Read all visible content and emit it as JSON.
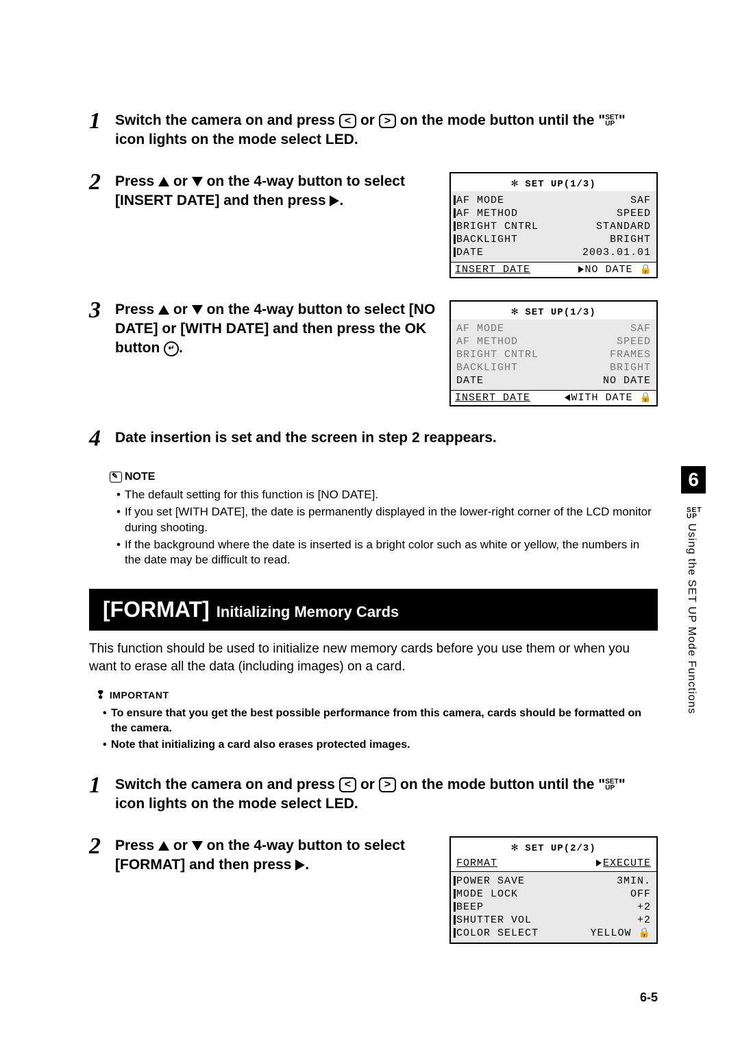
{
  "steps_a": {
    "s1": {
      "pre": "Switch the camera on and press ",
      "mid": " or ",
      "post": " on the mode button until the \"",
      "post2": "\" icon lights on the mode select LED."
    },
    "s2": {
      "pre": "Press ",
      "mid": " or ",
      "post": " on the 4-way button to select [INSERT DATE] and then press ",
      "post2": "."
    },
    "s3": {
      "pre": "Press ",
      "mid": " or ",
      "post": " on the 4-way button to select [NO DATE] or [WITH DATE] and then press the OK button ",
      "post2": "."
    },
    "s4": "Date insertion is set and the screen in step 2 reappears."
  },
  "setup1": {
    "title": "SET UP(1/3)",
    "rows": [
      {
        "label": "AF MODE",
        "value": "SAF"
      },
      {
        "label": "AF METHOD",
        "value": "SPEED"
      },
      {
        "label": "BRIGHT CNTRL",
        "value": "STANDARD"
      },
      {
        "label": "BACKLIGHT",
        "value": "BRIGHT"
      },
      {
        "label": "DATE",
        "value": "2003.01.01"
      }
    ],
    "footer": {
      "label": "INSERT DATE",
      "value": "NO DATE"
    }
  },
  "setup2": {
    "title": "SET UP(1/3)",
    "rows": [
      {
        "label": "AF MODE",
        "value": "SAF"
      },
      {
        "label": "AF METHOD",
        "value": "SPEED"
      },
      {
        "label": "BRIGHT CNTRL",
        "value": "FRAMES"
      },
      {
        "label": "BACKLIGHT",
        "value": "BRIGHT"
      },
      {
        "label": "DATE",
        "value": "NO DATE"
      }
    ],
    "footer": {
      "label": "INSERT DATE",
      "value": "WITH DATE"
    }
  },
  "note_label": "NOTE",
  "notes": [
    "The default setting for this function is [NO DATE].",
    "If you set [WITH DATE], the date is permanently displayed in the lower-right corner of the LCD monitor during shooting.",
    "If the background where the date is inserted is a bright color such as white or yellow, the numbers in the date may be difficult to read."
  ],
  "section": {
    "big": "[FORMAT]",
    "rest": "Initializing Memory Cards"
  },
  "intro": "This function should be used to initialize new memory cards before you use them or when you want to erase all the data (including images) on a card.",
  "important_label": "IMPORTANT",
  "importants": [
    "To ensure that you get the best possible performance from this camera, cards should be formatted on the camera.",
    "Note that initializing a card also erases protected images."
  ],
  "steps_b": {
    "s1": {
      "pre": "Switch the camera on and press ",
      "mid": " or ",
      "post": " on the mode button until the \"",
      "post2": "\" icon lights on the mode select LED."
    },
    "s2": {
      "pre": "Press ",
      "mid": " or ",
      "post": " on the 4-way button to select [FORMAT] and then press ",
      "post2": "."
    }
  },
  "setup3": {
    "title": "SET UP(2/3)",
    "rows_top": {
      "label": "FORMAT",
      "value": "EXECUTE"
    },
    "rows": [
      {
        "label": "POWER SAVE",
        "value": "3MIN."
      },
      {
        "label": "MODE LOCK",
        "value": "OFF"
      },
      {
        "label": "BEEP",
        "value": "+2"
      },
      {
        "label": "SHUTTER VOL",
        "value": "+2"
      },
      {
        "label": "COLOR SELECT",
        "value": "YELLOW"
      }
    ]
  },
  "side": {
    "num": "6",
    "text": "Using the SET UP Mode Functions"
  },
  "setup_icon": "SET\nUP",
  "page_num": "6-5"
}
